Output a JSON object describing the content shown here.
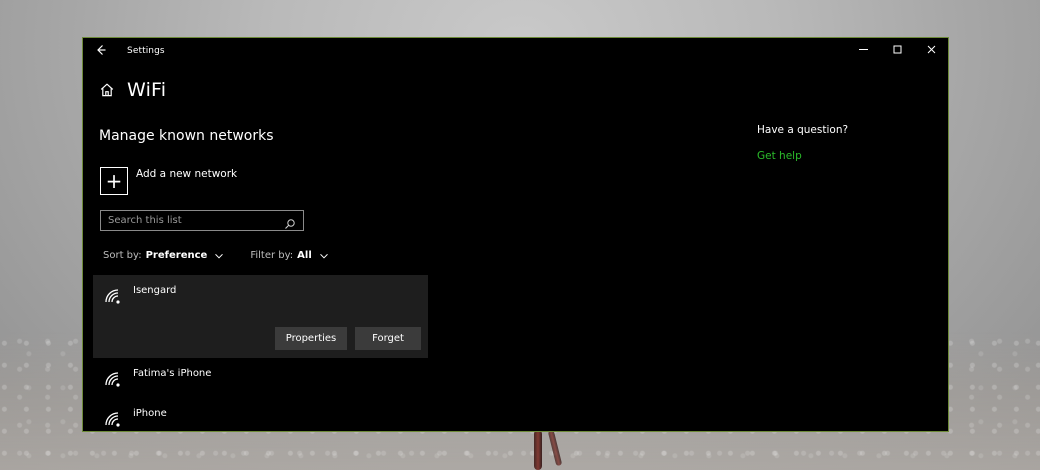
{
  "window": {
    "title": "Settings",
    "controls": {
      "minimize": "—",
      "maximize": "☐",
      "close": "✕"
    }
  },
  "page": {
    "title": "WiFi",
    "section_title": "Manage known networks"
  },
  "add_network": {
    "label": "Add a new network",
    "icon": "plus-icon",
    "symbol": "+"
  },
  "search": {
    "placeholder": "Search this list",
    "value": ""
  },
  "filters": {
    "sort_label": "Sort by:",
    "sort_value": "Preference",
    "filter_label": "Filter by:",
    "filter_value": "All"
  },
  "networks": [
    {
      "name": "Isengard",
      "selected": true
    },
    {
      "name": "Fatima's iPhone",
      "selected": false
    },
    {
      "name": "iPhone",
      "selected": false
    }
  ],
  "network_actions": {
    "properties": "Properties",
    "forget": "Forget"
  },
  "help": {
    "title": "Have a question?",
    "link": "Get help"
  },
  "colors": {
    "window_bg": "#000000",
    "accent_border": "#6d8a38",
    "selected_item_bg": "#1e1e1e",
    "button_bg": "#3b3b3b",
    "link_green": "#2bbd2b"
  },
  "icons": {
    "back": "back-arrow-icon",
    "home": "home-icon",
    "search": "search-icon",
    "chevron": "chevron-down-icon",
    "wifi": "wifi-icon"
  }
}
